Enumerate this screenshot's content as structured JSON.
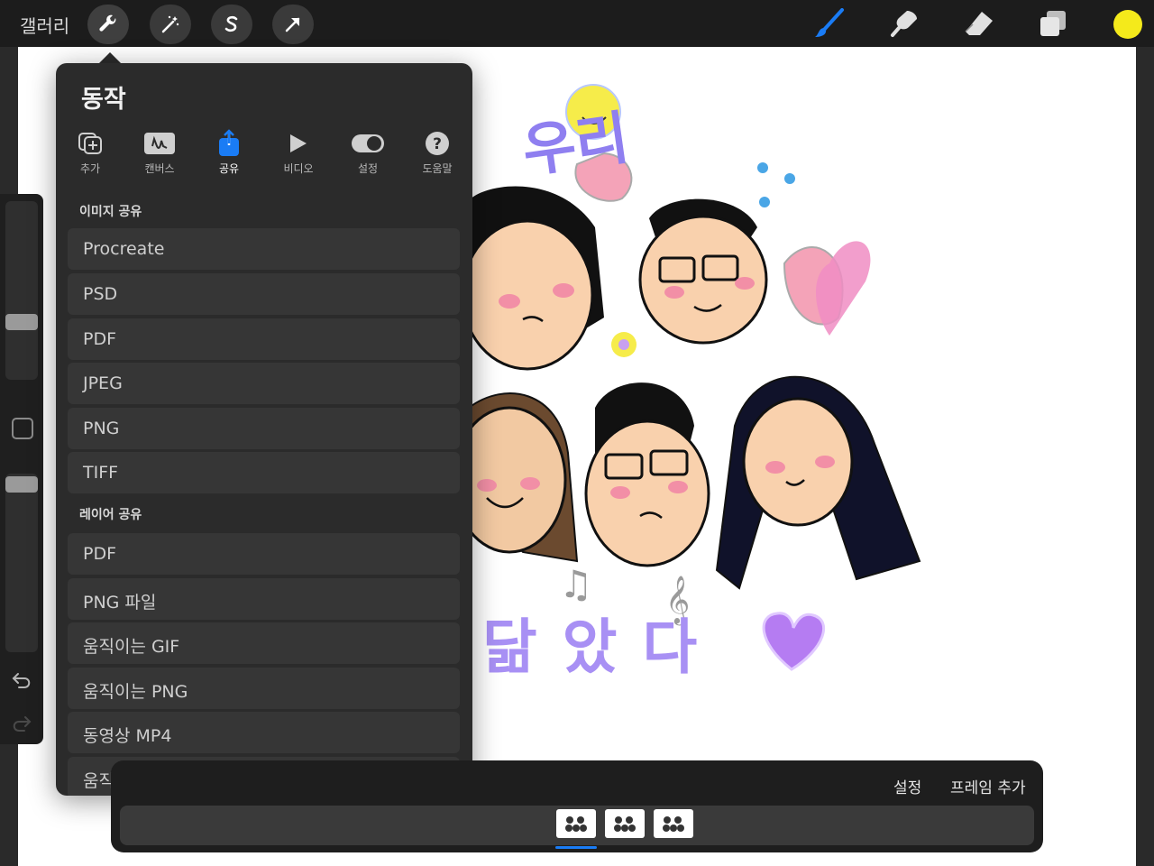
{
  "topbar": {
    "gallery_label": "갤러리",
    "tools": [
      "wrench-icon",
      "magic-wand-icon",
      "selection-s-icon",
      "arrow-transform-icon"
    ],
    "right_tools": [
      "brush-icon",
      "smudge-icon",
      "eraser-icon",
      "layers-icon"
    ],
    "color": "#f4ea1b"
  },
  "panel": {
    "title": "동작",
    "tabs": [
      {
        "label": "추가",
        "icon": "add-icon"
      },
      {
        "label": "캔버스",
        "icon": "canvas-icon"
      },
      {
        "label": "공유",
        "icon": "share-icon",
        "active": true
      },
      {
        "label": "비디오",
        "icon": "play-icon"
      },
      {
        "label": "설정",
        "icon": "toggle-icon"
      },
      {
        "label": "도움말",
        "icon": "help-icon"
      }
    ],
    "image_share_label": "이미지 공유",
    "image_share": [
      "Procreate",
      "PSD",
      "PDF",
      "JPEG",
      "PNG",
      "TIFF"
    ],
    "layer_share_label": "레이어 공유",
    "layer_share": [
      "PDF",
      "PNG 파일",
      "움직이는 GIF",
      "움직이는 PNG",
      "동영상 MP4",
      "움직이는 HEVC"
    ]
  },
  "artwork": {
    "title_text": "우리",
    "bottom_text": "닮았다"
  },
  "timeline": {
    "settings_label": "설정",
    "add_frame_label": "프레임 추가",
    "frame_count": 3,
    "selected_frame": 1
  },
  "colors": {
    "accent": "#1a7cf5",
    "panel_bg": "#2b2b2b",
    "row_bg": "#363636"
  }
}
